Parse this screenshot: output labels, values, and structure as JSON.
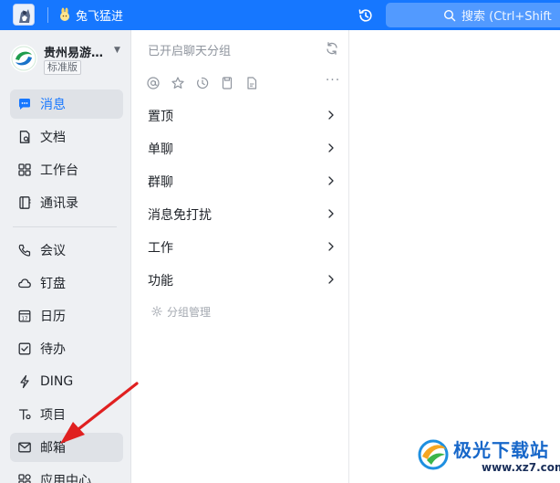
{
  "topbar": {
    "account_name": "兔飞猛进",
    "search_placeholder": "搜索 (Ctrl+Shift",
    "accent": "#1677ff"
  },
  "org": {
    "name": "贵州易游…",
    "badge": "标准版"
  },
  "nav": {
    "items": [
      {
        "label": "消息",
        "icon": "message-icon",
        "active": true
      },
      {
        "label": "文档",
        "icon": "document-icon"
      },
      {
        "label": "工作台",
        "icon": "workbench-grid-icon"
      },
      {
        "label": "通讯录",
        "icon": "contacts-book-icon"
      },
      {
        "label": "会议",
        "icon": "phone-meeting-icon"
      },
      {
        "label": "钉盘",
        "icon": "cloud-drive-icon"
      },
      {
        "label": "日历",
        "icon": "calendar-icon"
      },
      {
        "label": "待办",
        "icon": "todo-check-icon"
      },
      {
        "label": "DING",
        "icon": "lightning-icon"
      },
      {
        "label": "项目",
        "icon": "project-icon"
      },
      {
        "label": "邮箱",
        "icon": "mail-icon",
        "active": true
      },
      {
        "label": "应用中心",
        "icon": "app-center-icon"
      }
    ]
  },
  "panel": {
    "header": "已开启聊天分组",
    "filters": [
      "mention-icon",
      "star-icon",
      "clock-icon",
      "save-icon",
      "file-icon"
    ],
    "groups": [
      {
        "label": "置顶"
      },
      {
        "label": "单聊"
      },
      {
        "label": "群聊"
      },
      {
        "label": "消息免打扰"
      },
      {
        "label": "工作"
      },
      {
        "label": "功能"
      }
    ],
    "manage_label": "分组管理"
  },
  "watermark": {
    "title": "极光下载站",
    "url": "www.xz7.com"
  }
}
